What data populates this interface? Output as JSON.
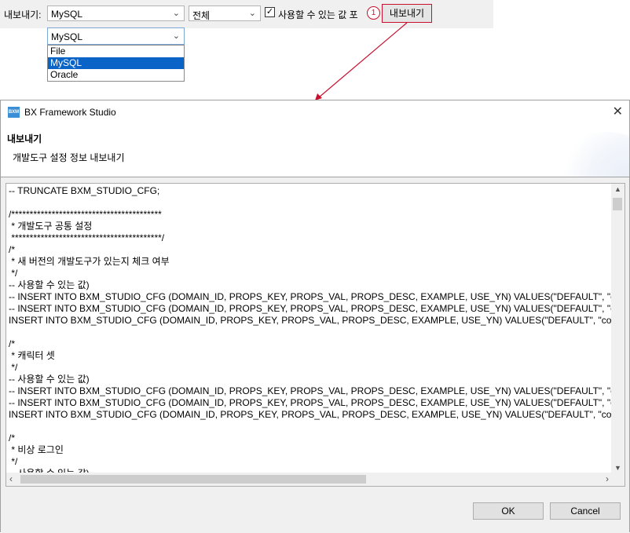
{
  "toolbar": {
    "export_label": "내보내기:",
    "db_combo_value": "MySQL",
    "scope_combo_value": "전체",
    "checkbox_label": "사용할 수 있는 값 포",
    "checkbox_checked": true,
    "step_badge": "1",
    "export_button": "내보내기"
  },
  "dropdown": {
    "selected": "MySQL",
    "options": [
      "File",
      "MySQL",
      "Oracle"
    ]
  },
  "dialog": {
    "title": "BX Framework Studio",
    "icon_text": "BXM",
    "header_title": "내보내기",
    "header_desc": "개발도구 설정 정보 내보내기",
    "code_lines": [
      "-- TRUNCATE BXM_STUDIO_CFG;",
      "",
      "/*****************************************",
      " * 개발도구 공통 설정",
      " *****************************************/",
      "/*",
      " * 새 버전의 개발도구가 있는지 체크 여부",
      " */",
      "-- 사용할 수 있는 값)",
      "-- INSERT INTO BXM_STUDIO_CFG (DOMAIN_ID, PROPS_KEY, PROPS_VAL, PROPS_DESC, EXAMPLE, USE_YN) VALUES(\"DEFAULT\", \"commonC",
      "-- INSERT INTO BXM_STUDIO_CFG (DOMAIN_ID, PROPS_KEY, PROPS_VAL, PROPS_DESC, EXAMPLE, USE_YN) VALUES(\"DEFAULT\", \"commonC",
      "INSERT INTO BXM_STUDIO_CFG (DOMAIN_ID, PROPS_KEY, PROPS_VAL, PROPS_DESC, EXAMPLE, USE_YN) VALUES(\"DEFAULT\", \"commonCor",
      "",
      "/*",
      " * 캐릭터 셋",
      " */",
      "-- 사용할 수 있는 값)",
      "-- INSERT INTO BXM_STUDIO_CFG (DOMAIN_ID, PROPS_KEY, PROPS_VAL, PROPS_DESC, EXAMPLE, USE_YN) VALUES(\"DEFAULT\", \"commonC",
      "-- INSERT INTO BXM_STUDIO_CFG (DOMAIN_ID, PROPS_KEY, PROPS_VAL, PROPS_DESC, EXAMPLE, USE_YN) VALUES(\"DEFAULT\", \"commonC",
      "INSERT INTO BXM_STUDIO_CFG (DOMAIN_ID, PROPS_KEY, PROPS_VAL, PROPS_DESC, EXAMPLE, USE_YN) VALUES(\"DEFAULT\", \"commonCor",
      "",
      "/*",
      " * 비상 로그인",
      " */",
      "-- 사용할 수 있는 값)"
    ],
    "ok_label": "OK",
    "cancel_label": "Cancel"
  },
  "colors": {
    "annotation_red": "#c8102e",
    "selection_blue": "#0a64c8"
  }
}
